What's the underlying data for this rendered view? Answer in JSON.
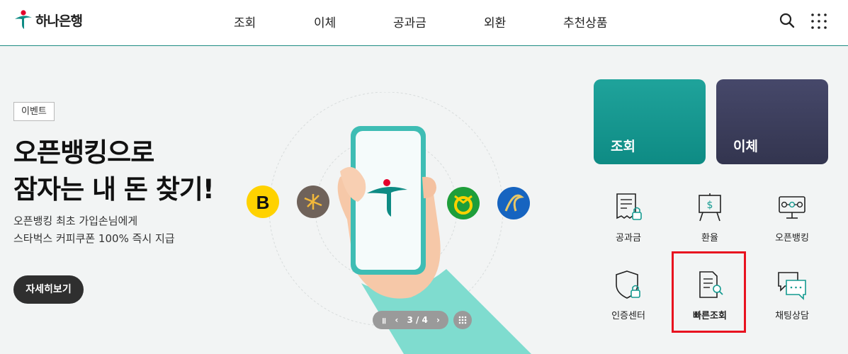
{
  "header": {
    "logo_text": "하나은행",
    "nav": [
      "조회",
      "이체",
      "공과금",
      "외환",
      "추천상품"
    ],
    "icons": [
      "search-icon",
      "all-menu-icon"
    ]
  },
  "hero": {
    "badge": "이벤트",
    "headline_line1": "오픈뱅킹으로",
    "headline_line2": "잠자는 내 돈 찾기!",
    "sub_line1": "오픈뱅킹 최초 가입손님에게",
    "sub_line2": "스타벅스 커피쿠폰 100% 즉시 지급",
    "detail_button": "자세히보기",
    "logo_letter": "B"
  },
  "slider": {
    "pause": "॥",
    "prev": "‹",
    "counter": "3 / 4",
    "next": "›"
  },
  "quick_menu": {
    "tiles": [
      "조회",
      "이체"
    ],
    "items": [
      "공과금",
      "환율",
      "오픈뱅킹",
      "인증센터",
      "빠른조회",
      "채팅상담"
    ]
  },
  "colors": {
    "brand": "#0e8b84",
    "brand_red": "#e4002b",
    "transfer_tile": "#3a3c58",
    "highlight": "#e8121f"
  }
}
